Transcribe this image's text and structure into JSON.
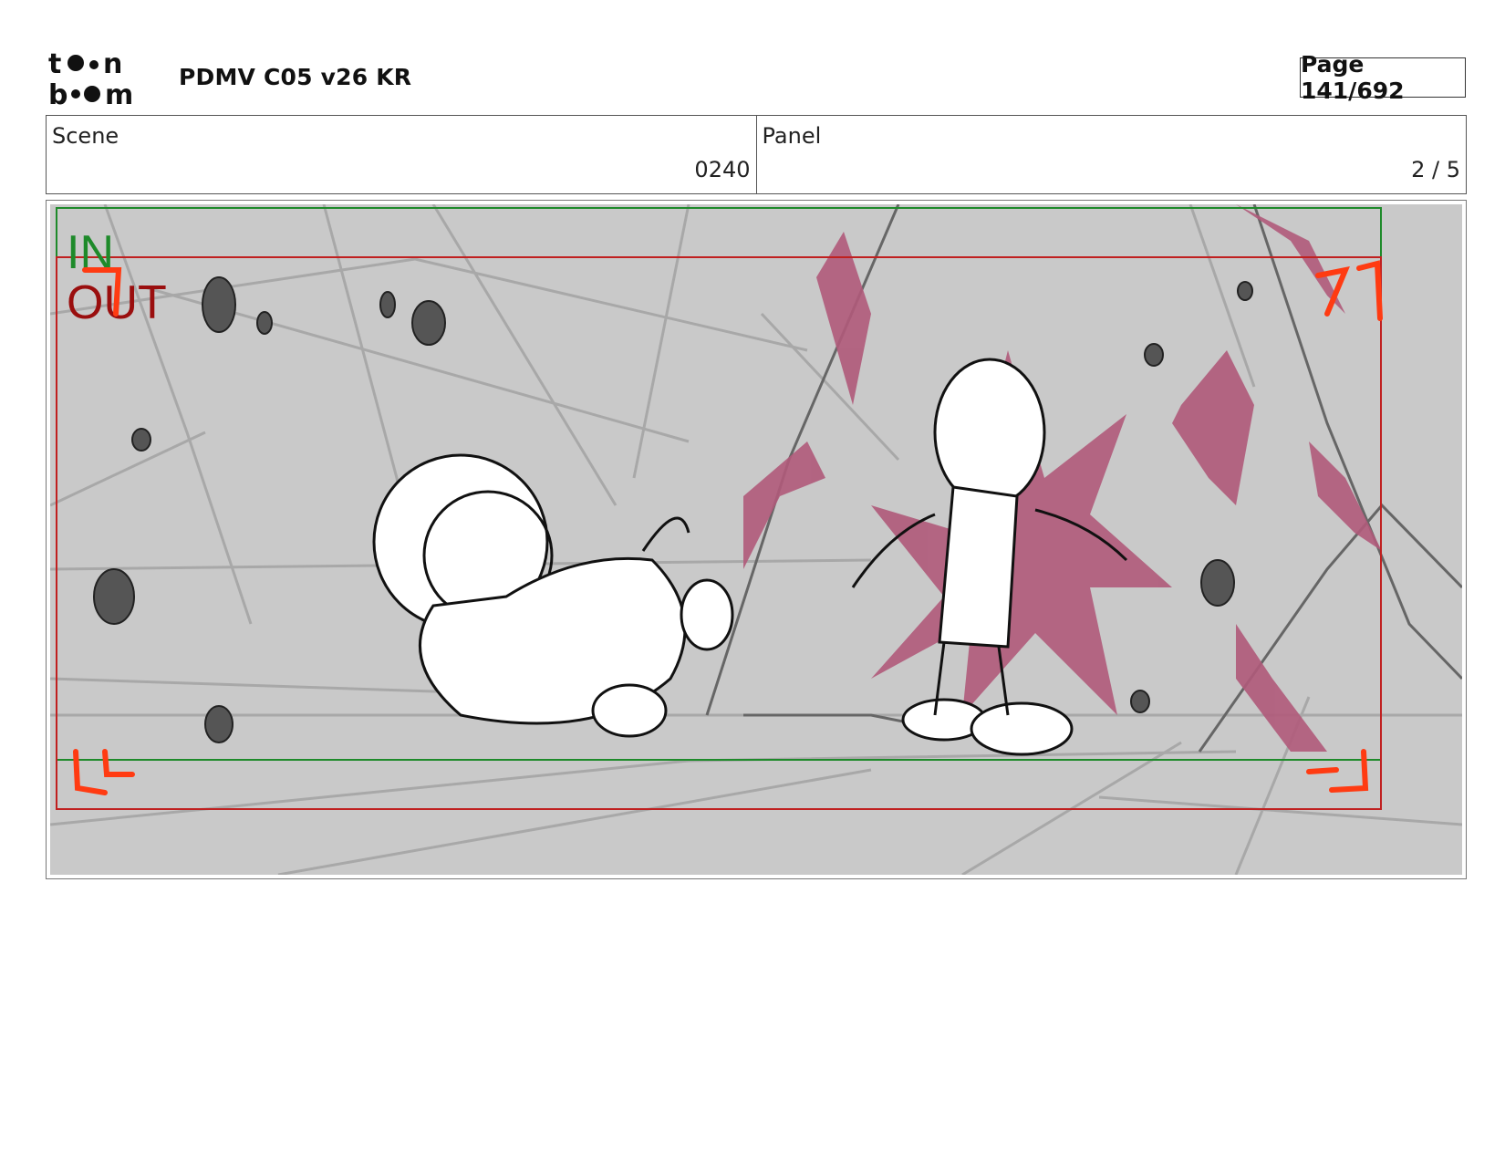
{
  "header": {
    "logo_text": "toonboom",
    "project_title": "PDMV C05 v26 KR",
    "page_label": "Page 141/692"
  },
  "info": {
    "scene_label": "Scene",
    "scene_value": "0240",
    "panel_label": "Panel",
    "panel_value": "2 / 5"
  },
  "panel": {
    "in_label": "IN",
    "out_label": "OUT",
    "colors": {
      "background": "#c9c9c9",
      "in_frame": "#1e8a2a",
      "out_frame": "#c02020",
      "corner_marks": "#ff3b12",
      "accent_paint": "#b05a7a",
      "sketch_lines": "#a8a8a8",
      "rocks": "#555555"
    }
  }
}
